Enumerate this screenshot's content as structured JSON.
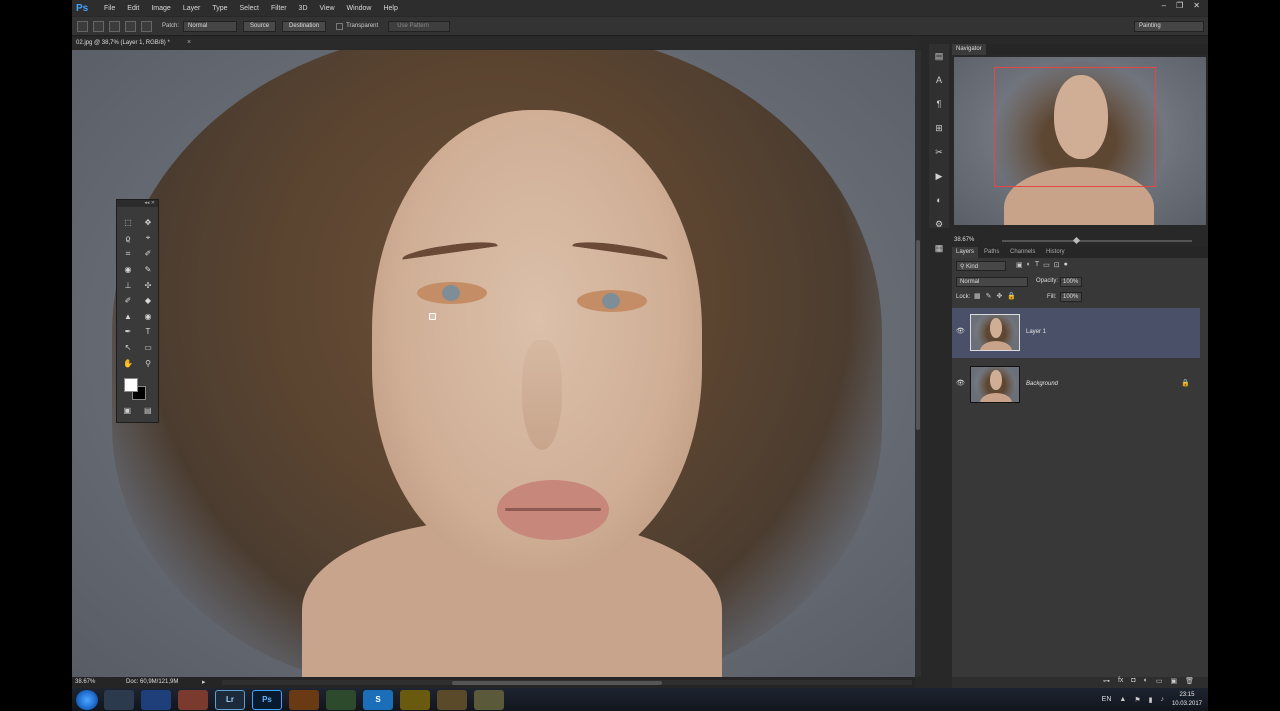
{
  "menubar": {
    "logo": "Ps",
    "items": [
      "File",
      "Edit",
      "Image",
      "Layer",
      "Type",
      "Select",
      "Filter",
      "3D",
      "View",
      "Window",
      "Help"
    ],
    "window_controls": {
      "minimize": "–",
      "restore": "❐",
      "close": "✕"
    }
  },
  "options": {
    "patch_label": "Patch:",
    "patch_value": "Normal",
    "source_label": "Source",
    "destination_label": "Destination",
    "transparent_label": "Transparent",
    "use_pattern_label": "Use Pattern",
    "workspace": "Painting"
  },
  "document": {
    "tab_title": "02.jpg @ 38,7% (Layer 1, RGB/8) *",
    "tab_close": "×",
    "status_zoom": "38.67%",
    "status_doc": "Doc: 60,9M/121,9M",
    "status_arrow": "▸"
  },
  "toolbox": {
    "collapse": "◂◂ ✕",
    "tools": [
      "⬚",
      "✥",
      "ϱ",
      "⌖",
      "⌗",
      "✐",
      "◉",
      "✎",
      "⊥",
      "✣",
      "✐",
      "◆",
      "▲",
      "◉",
      "✒",
      "T",
      "↖",
      "▭",
      "✋",
      "⚲"
    ],
    "bottom": [
      "▣",
      "▤"
    ]
  },
  "iconstrip": {
    "icons": [
      "▤",
      "A",
      "¶",
      "⊞",
      "✂",
      "▶",
      "◐",
      "⚙",
      "▦"
    ]
  },
  "navigator": {
    "tab": "Navigator",
    "zoom": "38.67%"
  },
  "layers_panel": {
    "tabs": [
      "Layers",
      "Paths",
      "Channels",
      "History"
    ],
    "kind": "⚲ Kind",
    "kind_icons": [
      "▣",
      "◐",
      "T",
      "▭",
      "⊡",
      "●"
    ],
    "blend_mode": "Normal",
    "opacity_label": "Opacity:",
    "opacity_value": "100%",
    "lock_label": "Lock:",
    "lock_icons": [
      "▦",
      "✎",
      "✥",
      "🔒"
    ],
    "fill_label": "Fill:",
    "fill_value": "100%",
    "layers": [
      {
        "name": "Layer 1",
        "visible_icon": "👁",
        "selected": true
      },
      {
        "name": "Background",
        "visible_icon": "👁",
        "locked_icon": "🔒"
      }
    ],
    "footer_icons": [
      "⊶",
      "fx",
      "◘",
      "◐",
      "▭",
      "▣",
      "🗑"
    ]
  },
  "taskbar": {
    "apps": [
      "",
      "",
      "",
      "Lr",
      "Ps",
      "",
      "",
      "S",
      "",
      "",
      ""
    ],
    "tray_lang": "EN",
    "tray_icons": [
      "▲",
      "⚑",
      "▮",
      "♪"
    ],
    "time": "23:15",
    "date": "10.03.2017"
  },
  "colors": {
    "ps_blue": "#3fa3ff",
    "layer_selected": "#4b5069",
    "navigator_frame": "#e64646"
  }
}
